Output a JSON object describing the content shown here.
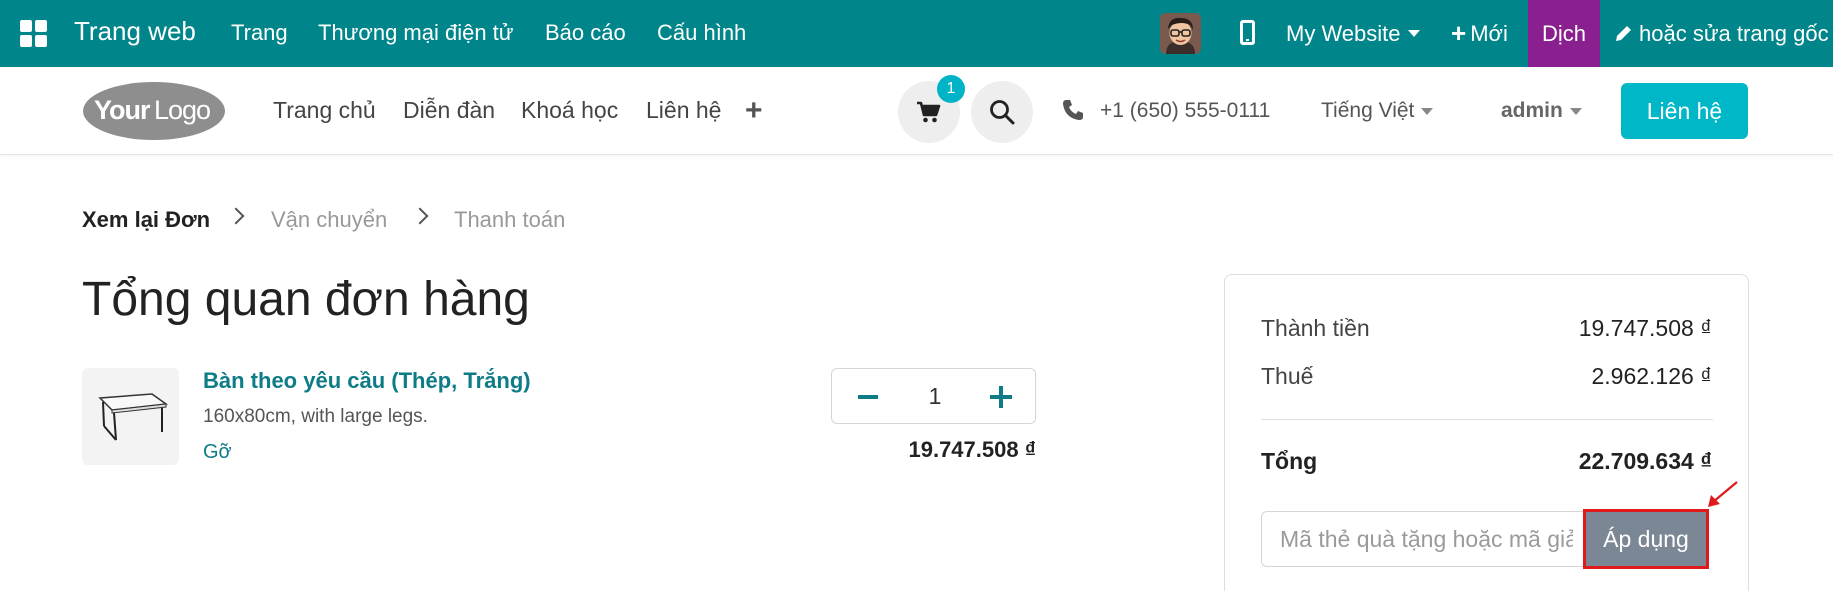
{
  "topbar": {
    "brand": "Trang web",
    "menus": [
      "Trang",
      "Thương mại điện tử",
      "Báo cáo",
      "Cấu hình"
    ],
    "website_label": "My Website",
    "new_label": "Mới",
    "translate_label": "Dịch",
    "edit_label": "hoặc sửa trang gốc",
    "bg_color": "#00868a",
    "translate_color": "#8a2090"
  },
  "header": {
    "logo_text": "YourLogo",
    "nav": [
      "Trang chủ",
      "Diễn đàn",
      "Khoá học",
      "Liên hệ"
    ],
    "cart_count": "1",
    "phone": "+1 (650) 555-0111",
    "language": "Tiếng Việt",
    "user": "admin",
    "contact_button": "Liên hệ",
    "accent_color": "#00b7c8"
  },
  "checkout_steps": [
    {
      "label": "Xem lại Đơn",
      "active": true
    },
    {
      "label": "Vận chuyển",
      "active": false
    },
    {
      "label": "Thanh toán",
      "active": false
    }
  ],
  "page_title": "Tổng quan đơn hàng",
  "order_line": {
    "product_name": "Bàn theo yêu cầu (Thép, Trắng)",
    "description": "160x80cm, with large legs.",
    "remove_label": "Gỡ",
    "quantity": "1",
    "price": "19.747.508 ₫"
  },
  "summary": {
    "subtotal_label": "Thành tiền",
    "subtotal_value": "19.747.508 ₫",
    "tax_label": "Thuế",
    "tax_value": "2.962.126 ₫",
    "total_label": "Tổng",
    "total_value": "22.709.634 ₫",
    "coupon_placeholder": "Mã thẻ quà tặng hoặc mã giảm giá",
    "apply_label": "Áp dụng"
  }
}
